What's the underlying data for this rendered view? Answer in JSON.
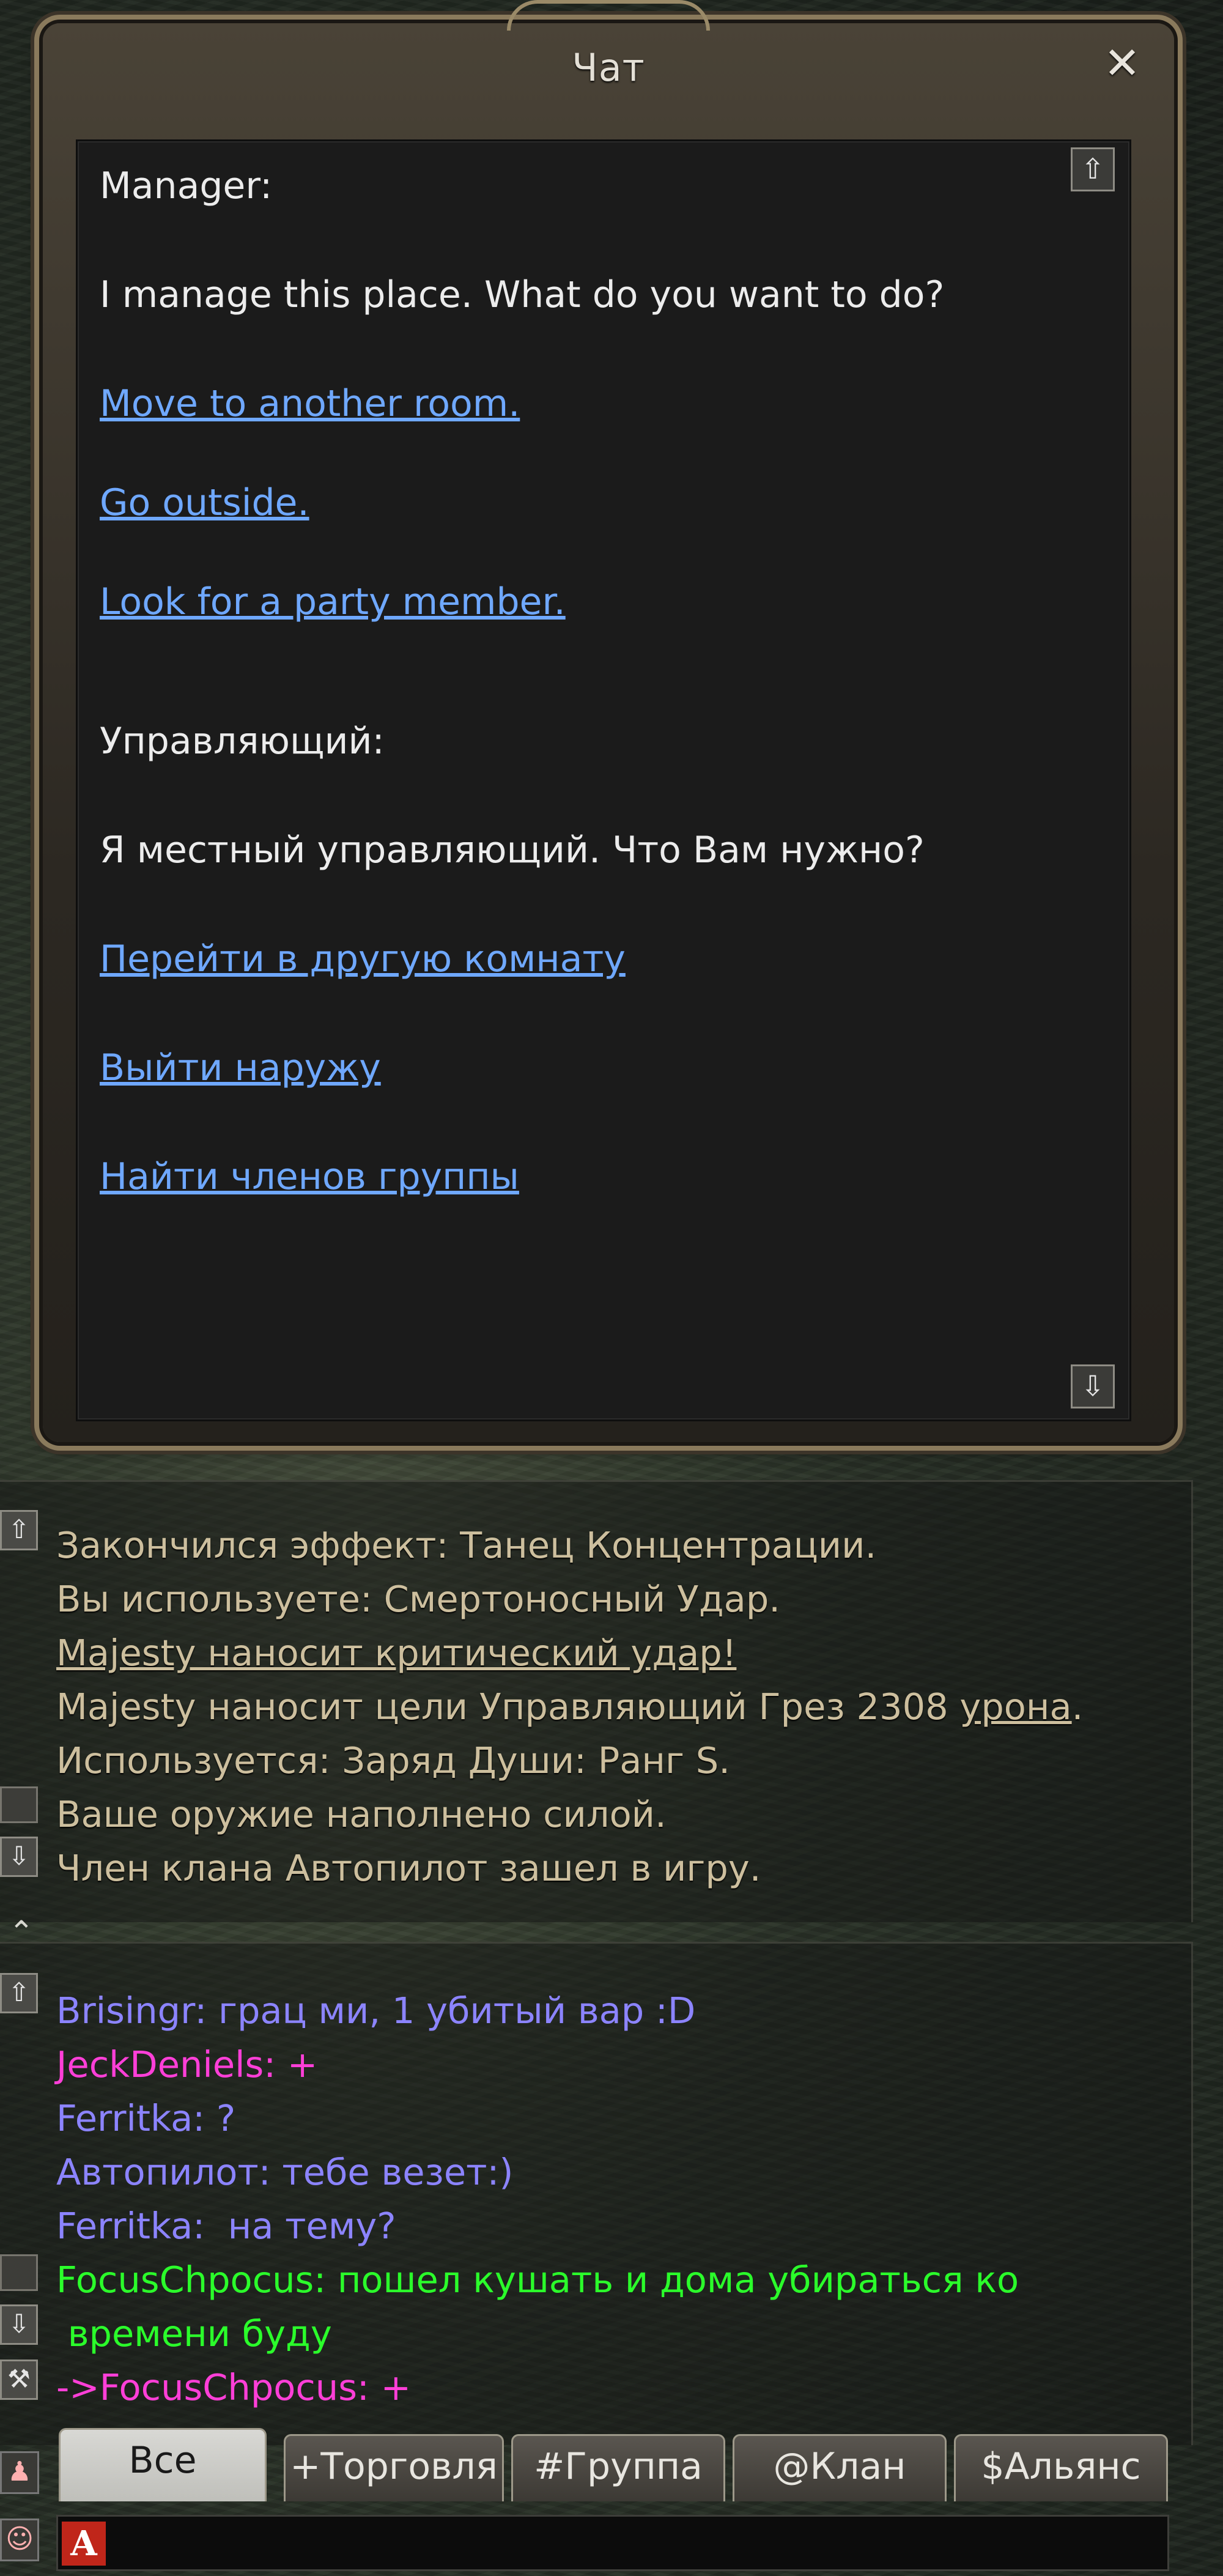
{
  "dialog": {
    "title": "Чат",
    "close": "✕",
    "scroll_up": "⇧",
    "scroll_down": "⇩",
    "en_speaker": "Manager:",
    "en_text": "I manage this place. What do you want to do?",
    "en_links": [
      "Move to another room.",
      "Go outside.",
      "Look for a party member."
    ],
    "ru_speaker": "Управляющий:",
    "ru_text": "Я местный управляющий. Что Вам нужно?",
    "ru_links": [
      "Перейти в другую комнату",
      "Выйти наружу",
      "Найти членов группы"
    ]
  },
  "system_log": {
    "lines": [
      "Закончился эффект: Танец Концентрации.",
      "Вы используете: Смертоносный Удар.",
      "Majesty наносит критический удар!",
      "Majesty наносит цели Управляющий Грез 2308 ",
      "урона",
      ".",
      "Используется: Заряд Души: Ранг S.",
      "Ваше оружие наполнено силой.",
      "Член клана Автопилот зашел в игру."
    ]
  },
  "chat": {
    "lines": [
      "Brisingr: грац ми, 1 убитый вар :D",
      "JeckDeniels: +",
      "Ferritka: ?",
      "Автопилот: тебе везет:)",
      "Ferritka:  на тему?",
      "FocusChpocus: пошел кушать и дома убираться ко",
      " времени буду",
      "->FocusChpocus: +"
    ],
    "colors": {
      "blue": "#8c84ff",
      "magenta": "#ff3fd8",
      "green": "#2bff2b"
    }
  },
  "tabs": [
    "Все",
    "+Торговля",
    "#Группа",
    "@Клан",
    "$Альянс"
  ],
  "input": {
    "lang_badge": "A",
    "value": ""
  }
}
